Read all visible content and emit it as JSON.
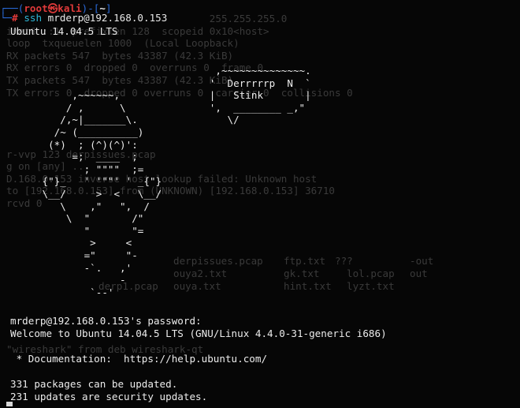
{
  "prompt": {
    "line1_lead": "┌──(",
    "user": "root",
    "at": "㉿",
    "host": "kali",
    "mid": ")-[",
    "dir": "~",
    "close": "]",
    "line2_lead": "└─",
    "hash": "# ",
    "cmd": "ssh",
    "arg": " mrderp@192.168.0.153"
  },
  "output": {
    "banner": "Ubuntu 14.04.5 LTS",
    "art": "                                   ,~~~~~~~~~~~~~~.\n                                  '  Derrrrrp  N  `\n           ,~~~~~~,               |   Stink       |\n          / ,      \\              ',  ________ _,\"\n         /,~|_______\\.               \\/\n        /~ (__________)\n       (*)  ; (^)(^)':\n           =;  ____  ;\n             ; \"\"\"\"  ;=\n      {\"}_   ' '\"\"' ' _{\"}\n      \\__/     >  <   \\__/\n         \\    ,\"   \",  /\n          \\  \"       /\"\n             \"       \"=\n              >     <\n             =\"     \"-\n             -`.   ,'\n                   -\n              `--'",
    "password_prompt": "mrderp@192.168.0.153's password:",
    "welcome": "Welcome to Ubuntu 14.04.5 LTS (GNU/Linux 4.4.0-31-generic i686)",
    "documentation": " * Documentation:  https://help.ubuntu.com/",
    "updates1": "331 packages can be updated.",
    "updates2": "231 updates are security updates."
  },
  "ghost": {
    "lines": [
      "                                  255.255.255.0",
      "inet6 ::1  prefixlen 128  scopeid 0x10<host>",
      "loop  txqueuelen 1000  (Local Loopback)",
      "RX packets 547  bytes 43387 (42.3 KiB)",
      "RX errors 0  dropped 0  overruns 0  frame 0",
      "TX packets 547  bytes 43387 (42.3 KiB)",
      "TX errors 0  dropped 0 overruns 0  carrier 0  collisions 0",
      "",
      "",
      "",
      "",
      "r-vvp 123 derpissues.pcap",
      "g on [any] ...",
      "D.168.0.153 inverse host lookup failed: Unknown host",
      "to [192.168.0.153] from (UNKNOWN) [192.168.0.153] 36710",
      "rcvd 0"
    ],
    "grid": [
      "derpissues.pcap",
      "ftp.txt",
      "???",
      "-out",
      "ouya2.txt",
      "gk.txt",
      "lol.pcap",
      "out",
      "derp1.pcap",
      "ouya.txt",
      "hint.txt",
      "lyzt.txt",
      "\"wireshark\" from deb wireshark-qt"
    ]
  }
}
